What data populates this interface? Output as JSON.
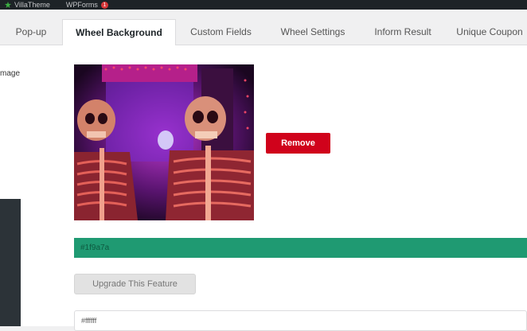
{
  "admin_bar": {
    "items": [
      {
        "label": "VillaTheme",
        "icon": "star-icon"
      },
      {
        "label": "WPForms",
        "badge": "1"
      }
    ]
  },
  "tabs": [
    {
      "label": "Pop-up",
      "active": false
    },
    {
      "label": "Wheel Background",
      "active": true
    },
    {
      "label": "Custom Fields",
      "active": false
    },
    {
      "label": "Wheel Settings",
      "active": false
    },
    {
      "label": "Inform Result",
      "active": false
    },
    {
      "label": "Unique Coupon",
      "active": false
    }
  ],
  "panel": {
    "image_label": "mage",
    "remove_label": "Remove",
    "color_value": "#1f9a7a",
    "upgrade_label": "Upgrade This Feature",
    "text_input_value": "#ffffff"
  },
  "colors": {
    "admin_bar": "#1d2327",
    "remove_button": "#d0021b",
    "color_bar": "#1f9a72",
    "badge": "#d63638"
  }
}
